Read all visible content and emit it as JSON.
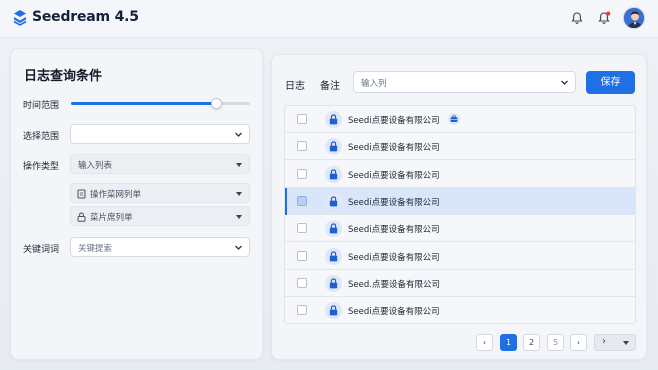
{
  "app": {
    "title": "Seedream 4.5"
  },
  "colors": {
    "accent": "#1f6fe5",
    "badge": "#e53935"
  },
  "header": {
    "icons": [
      "bell-icon",
      "notification-bell-icon",
      "user-avatar"
    ]
  },
  "filters": {
    "title": "日志查询条件",
    "time_range_label": "时间范围",
    "time_range_level": 0.81,
    "scope_label": "选择范围",
    "scope_value": "",
    "op_type_label": "操作类型",
    "op_type_value": "输入列表",
    "op_menu_value": "操作菜网列单",
    "menu_list_value": "菜片席列单",
    "keyword_label": "关键词词",
    "keyword_placeholder": "关键提索"
  },
  "log_panel": {
    "log_label": "日志",
    "note_label": "备注",
    "input_placeholder": "输入列",
    "save_label": "保存",
    "rows": [
      {
        "text": "Seedi点要设备有限公司",
        "selected": false,
        "badge": true
      },
      {
        "text": "Seedi点要设备有限公司",
        "selected": false,
        "badge": false
      },
      {
        "text": "Seedi点要设备有限公司",
        "selected": false,
        "badge": false
      },
      {
        "text": "Seedi点要设备有限公司",
        "selected": true,
        "badge": false
      },
      {
        "text": "Seedi点要设备有限公司",
        "selected": false,
        "badge": false
      },
      {
        "text": "Seedi点要设备有限公司",
        "selected": false,
        "badge": false
      },
      {
        "text": "Seed.点要设备有限公司",
        "selected": false,
        "badge": false
      },
      {
        "text": "Seedi点要设备有限公司",
        "selected": false,
        "badge": false
      }
    ]
  },
  "pagination": {
    "prev": "‹",
    "pages": [
      "1",
      "2",
      "5"
    ],
    "current": "1",
    "next": "›",
    "more": "›"
  }
}
